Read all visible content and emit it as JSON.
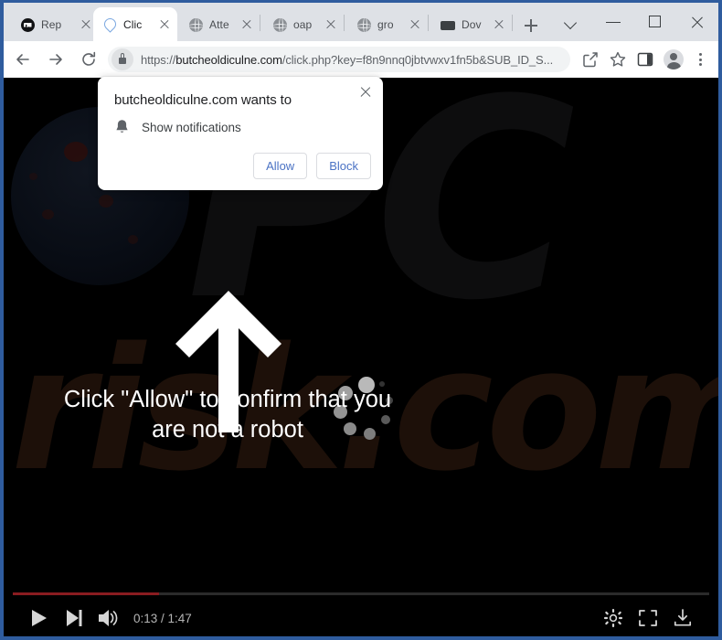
{
  "browser": {
    "tabs": [
      {
        "title": "Rep",
        "favicon": "black-circle-icon",
        "active": false
      },
      {
        "title": "Clic",
        "favicon": "blue-drop-icon",
        "active": true
      },
      {
        "title": "Atte",
        "favicon": "globe-icon",
        "active": false
      },
      {
        "title": "oap",
        "favicon": "globe-icon",
        "active": false
      },
      {
        "title": "gro",
        "favicon": "globe-icon",
        "active": false
      },
      {
        "title": "Dov",
        "favicon": "sofa-icon",
        "active": false
      }
    ],
    "new_tab_label": "+",
    "window_controls": {
      "tab_search": "tab-search-chevron",
      "minimize": "minimize",
      "maximize": "maximize",
      "close": "close"
    },
    "toolbar": {
      "back": "back-arrow",
      "forward": "forward-arrow",
      "reload": "reload",
      "security": "lock-icon",
      "url_scheme": "https://",
      "url_host": "butcheoldiculne.com",
      "url_path": "/click.php?key=f8n9nnq0jbtvwxv1fn5b&SUB_ID_S...",
      "url_full": "https://butcheoldiculne.com/click.php?key=f8n9nnq0jbtvwxv1fn5b&SUB_ID_S...",
      "share": "share-icon",
      "bookmark": "star-icon",
      "side_panel": "side-panel-icon",
      "profile": "profile-avatar",
      "menu": "three-dot-menu"
    }
  },
  "permission_dialog": {
    "title": "butcheoldiculne.com wants to",
    "permission_icon": "bell-icon",
    "permission_text": "Show notifications",
    "allow_label": "Allow",
    "block_label": "Block",
    "close_label": "Close",
    "link_color": "#4a72c4"
  },
  "page": {
    "background_color": "#000000",
    "watermark_top": "PC",
    "watermark_bottom": "risk.com",
    "arrow_icon": "up-arrow-icon",
    "spinner_icon": "loading-spinner-icon",
    "headline_line1": "Click \"Allow\" to confirm that you",
    "headline_line2": "are not a robot",
    "headline_color": "#ffffff"
  },
  "player": {
    "progress_percent": 21,
    "progress_color": "#8a1c20",
    "play": "play-icon",
    "next": "next-track-icon",
    "volume": "volume-icon",
    "time_display": "0:13 / 1:47",
    "current_time": "0:13",
    "duration": "1:47",
    "settings": "gear-icon",
    "fullscreen": "fullscreen-icon",
    "download": "download-icon"
  }
}
